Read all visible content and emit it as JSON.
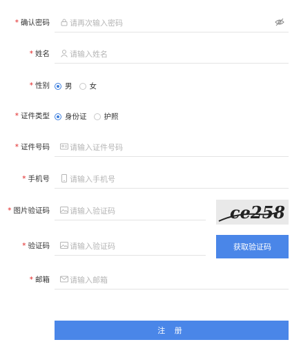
{
  "form": {
    "required_mark": "*",
    "confirm_password": {
      "label": "确认密码",
      "placeholder": "请再次输入密码",
      "value": ""
    },
    "name": {
      "label": "姓名",
      "placeholder": "请输入姓名",
      "value": ""
    },
    "gender": {
      "label": "性别",
      "options": [
        "男",
        "女"
      ],
      "selected": "男"
    },
    "id_type": {
      "label": "证件类型",
      "options": [
        "身份证",
        "护照"
      ],
      "selected": "身份证"
    },
    "id_number": {
      "label": "证件号码",
      "placeholder": "请输入证件号码",
      "value": ""
    },
    "phone": {
      "label": "手机号",
      "placeholder": "请输入手机号",
      "value": ""
    },
    "image_captcha": {
      "label": "图片验证码",
      "placeholder": "请输入验证码",
      "value": "",
      "captcha_text": "ce258"
    },
    "sms_code": {
      "label": "验证码",
      "placeholder": "请输入验证码",
      "value": "",
      "button_label": "获取验证码"
    },
    "email": {
      "label": "邮箱",
      "placeholder": "请输入邮箱",
      "value": ""
    },
    "submit_label": "注 册"
  },
  "colors": {
    "accent": "#4a86e8",
    "required": "#e02020",
    "placeholder": "#b5b5b5",
    "divider": "#e3e3e3"
  }
}
